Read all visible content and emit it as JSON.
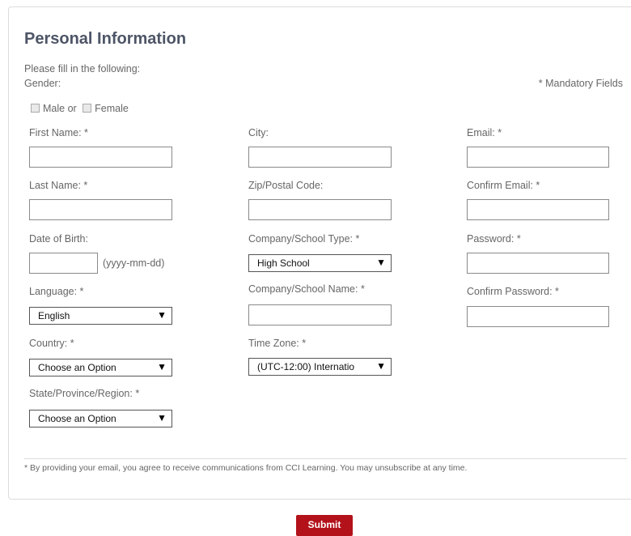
{
  "form": {
    "title": "Personal Information",
    "instructions": "Please fill in the following:",
    "mandatory_note": "* Mandatory Fields",
    "gender": {
      "label": "Gender:",
      "male": "Male or",
      "female": "Female"
    },
    "col1": {
      "first_name": "First Name: *",
      "last_name": "Last Name: *",
      "dob": "Date of Birth:",
      "dob_hint": "(yyyy-mm-dd)",
      "language": "Language: *",
      "language_value": "English",
      "country": "Country: *",
      "country_value": "Choose an Option",
      "state": "State/Province/Region: *",
      "state_value": "Choose an Option"
    },
    "col2": {
      "city": "City:",
      "zip": "Zip/Postal Code:",
      "company_type": "Company/School Type: *",
      "company_type_value": "High School",
      "company_name": "Company/School Name: *",
      "time_zone": "Time Zone: *",
      "time_zone_value": "(UTC-12:00) Internatio"
    },
    "col3": {
      "email": "Email: *",
      "confirm_email": "Confirm Email: *",
      "password": "Password: *",
      "confirm_password": "Confirm Password: *"
    },
    "footer_note": "* By providing your email, you agree to receive communications from CCI Learning. You may unsubscribe at any time.",
    "submit_label": "Submit"
  }
}
